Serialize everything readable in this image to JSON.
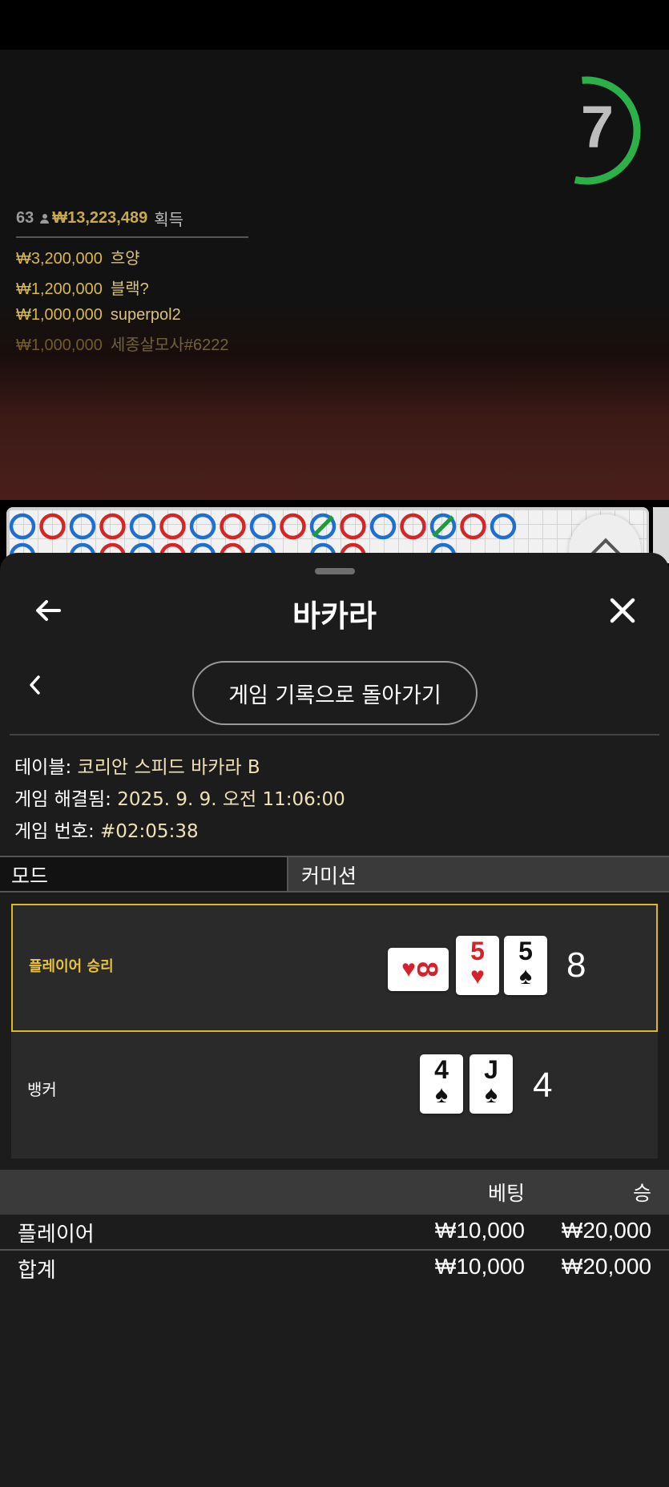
{
  "timer": {
    "seconds": "7",
    "progress_fraction": 0.55,
    "color": "#2bb04a"
  },
  "winners": {
    "count": "63",
    "total": "₩13,223,489",
    "suffix": "획득",
    "rows": [
      {
        "amount": "₩3,200,000",
        "name": "흐양"
      },
      {
        "amount": "₩1,200,000",
        "name": "블랙?"
      },
      {
        "amount": "₩1,000,000",
        "name": "superpol2"
      },
      {
        "amount": "₩1,000,000",
        "name": "세종살모사#6222"
      }
    ]
  },
  "road": {
    "top_row": [
      "P",
      "B",
      "P",
      "B",
      "P",
      "B",
      "P",
      "B",
      "P",
      "B",
      "T",
      "B",
      "P",
      "B",
      "T",
      "B",
      "P"
    ],
    "bottom_row": [
      "P",
      "",
      "P",
      "B",
      "P",
      "B",
      "P",
      "B",
      "P",
      "",
      "P",
      "B",
      "",
      "",
      "P",
      "",
      ""
    ],
    "colors": {
      "player": "#1f6fd1",
      "banker": "#d42626",
      "tie": "#1f9a3e"
    }
  },
  "sheet": {
    "title": "바카라",
    "back_icon": "arrow-left-icon",
    "close_icon": "close-icon",
    "history_button": "게임 기록으로 돌아가기",
    "info": {
      "table_label": "테이블:",
      "table_value": "코리안 스피드 바카라 B",
      "resolved_label": "게임 해결됨:",
      "resolved_value": "2025. 9. 9. 오전 11:06:00",
      "number_label": "게임 번호:",
      "number_value": "#02:05:38"
    },
    "mode_tab": "모드",
    "commission_tab": "커미션"
  },
  "result": {
    "player": {
      "label": "플레이어 승리",
      "score": "8",
      "cards": [
        {
          "rank": "8",
          "suit": "♥",
          "color": "red",
          "sideways": true
        },
        {
          "rank": "5",
          "suit": "♥",
          "color": "red",
          "sideways": false
        },
        {
          "rank": "5",
          "suit": "♠",
          "color": "black",
          "sideways": false
        }
      ]
    },
    "banker": {
      "label": "뱅커",
      "score": "4",
      "cards": [
        {
          "rank": "4",
          "suit": "♠",
          "color": "black",
          "sideways": false
        },
        {
          "rank": "J",
          "suit": "♠",
          "color": "black",
          "sideways": false
        }
      ]
    },
    "highlight_color": "#d9bb2a"
  },
  "bets": {
    "col_bet": "베팅",
    "col_win": "승",
    "rows": [
      {
        "label": "플레이어",
        "bet": "₩10,000",
        "win": "₩20,000"
      }
    ],
    "total": {
      "label": "합계",
      "bet": "₩10,000",
      "win": "₩20,000"
    }
  }
}
